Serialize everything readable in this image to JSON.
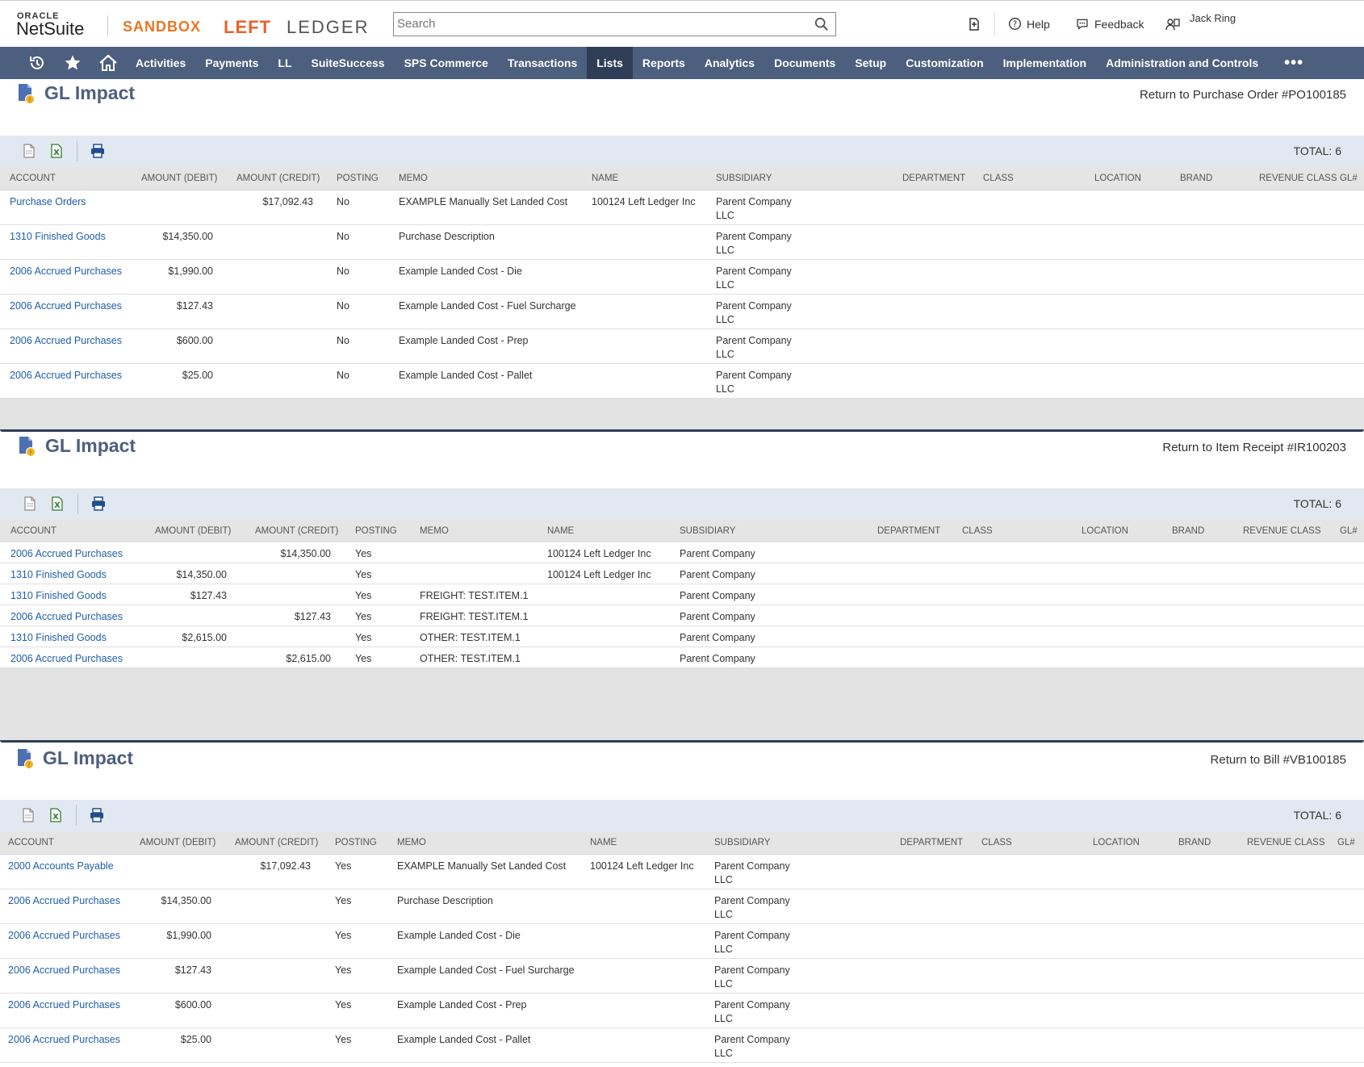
{
  "header": {
    "oracle": "ORACLE",
    "netsuite": "NetSuite",
    "sandbox": "SANDBOX",
    "brand_left": "LEFT",
    "brand_ledger": "LEDGER",
    "search_placeholder": "Search",
    "recent_icon": "recent-records-icon",
    "help": "Help",
    "feedback": "Feedback",
    "user": "Jack Ring"
  },
  "nav": {
    "items": [
      "Activities",
      "Payments",
      "LL",
      "SuiteSuccess",
      "SPS Commerce",
      "Transactions",
      "Lists",
      "Reports",
      "Analytics",
      "Documents",
      "Setup",
      "Customization",
      "Implementation",
      "Administration and Controls"
    ],
    "active": "Lists",
    "more": "•••"
  },
  "colors": {
    "nav_bg": "#4d5f7e",
    "nav_active": "#2f3e56",
    "link": "#1f5ea8",
    "title": "#4d5f7e"
  },
  "columns": [
    "ACCOUNT",
    "AMOUNT (DEBIT)",
    "AMOUNT (CREDIT)",
    "POSTING",
    "MEMO",
    "NAME",
    "SUBSIDIARY",
    "DEPARTMENT",
    "CLASS",
    "LOCATION",
    "BRAND",
    "REVENUE CLASS",
    "GL#"
  ],
  "sections": [
    {
      "title": "GL Impact",
      "return_link": "Return to Purchase Order #PO100185",
      "total": "TOTAL: 6",
      "rows": [
        {
          "account": "Purchase Orders",
          "debit": "",
          "credit": "$17,092.43",
          "posting": "No",
          "memo": "EXAMPLE Manually Set Landed Cost",
          "name": "100124 Left Ledger Inc",
          "subsidiary": "Parent Company LLC"
        },
        {
          "account": "1310 Finished Goods",
          "debit": "$14,350.00",
          "credit": "",
          "posting": "No",
          "memo": "Purchase Description",
          "name": "",
          "subsidiary": "Parent Company LLC"
        },
        {
          "account": "2006 Accrued Purchases",
          "debit": "$1,990.00",
          "credit": "",
          "posting": "No",
          "memo": "Example Landed Cost - Die",
          "name": "",
          "subsidiary": "Parent Company LLC"
        },
        {
          "account": "2006 Accrued Purchases",
          "debit": "$127.43",
          "credit": "",
          "posting": "No",
          "memo": "Example Landed Cost - Fuel Surcharge",
          "name": "",
          "subsidiary": "Parent Company LLC"
        },
        {
          "account": "2006 Accrued Purchases",
          "debit": "$600.00",
          "credit": "",
          "posting": "No",
          "memo": "Example Landed Cost - Prep",
          "name": "",
          "subsidiary": "Parent Company LLC"
        },
        {
          "account": "2006 Accrued Purchases",
          "debit": "$25.00",
          "credit": "",
          "posting": "No",
          "memo": "Example Landed Cost - Pallet",
          "name": "",
          "subsidiary": "Parent Company LLC"
        }
      ]
    },
    {
      "title": "GL Impact",
      "return_link": "Return to Item Receipt #IR100203",
      "total": "TOTAL: 6",
      "rows": [
        {
          "account": "2006 Accrued Purchases",
          "debit": "",
          "credit": "$14,350.00",
          "posting": "Yes",
          "memo": "",
          "name": "100124 Left Ledger Inc",
          "subsidiary": "Parent Company"
        },
        {
          "account": "1310 Finished Goods",
          "debit": "$14,350.00",
          "credit": "",
          "posting": "Yes",
          "memo": "",
          "name": "100124 Left Ledger Inc",
          "subsidiary": "Parent Company"
        },
        {
          "account": "1310 Finished Goods",
          "debit": "$127.43",
          "credit": "",
          "posting": "Yes",
          "memo": "FREIGHT: TEST.ITEM.1",
          "name": "",
          "subsidiary": "Parent Company"
        },
        {
          "account": "2006 Accrued Purchases",
          "debit": "",
          "credit": "$127.43",
          "posting": "Yes",
          "memo": "FREIGHT: TEST.ITEM.1",
          "name": "",
          "subsidiary": "Parent Company"
        },
        {
          "account": "1310 Finished Goods",
          "debit": "$2,615.00",
          "credit": "",
          "posting": "Yes",
          "memo": "OTHER: TEST.ITEM.1",
          "name": "",
          "subsidiary": "Parent Company"
        },
        {
          "account": "2006 Accrued Purchases",
          "debit": "",
          "credit": "$2,615.00",
          "posting": "Yes",
          "memo": "OTHER: TEST.ITEM.1",
          "name": "",
          "subsidiary": "Parent Company"
        }
      ]
    },
    {
      "title": "GL Impact",
      "return_link": "Return to Bill #VB100185",
      "total": "TOTAL: 6",
      "rows": [
        {
          "account": "2000 Accounts Payable",
          "debit": "",
          "credit": "$17,092.43",
          "posting": "Yes",
          "memo": "EXAMPLE Manually Set Landed Cost",
          "name": "100124 Left Ledger Inc",
          "subsidiary": "Parent Company LLC"
        },
        {
          "account": "2006 Accrued Purchases",
          "debit": "$14,350.00",
          "credit": "",
          "posting": "Yes",
          "memo": "Purchase Description",
          "name": "",
          "subsidiary": "Parent Company LLC"
        },
        {
          "account": "2006 Accrued Purchases",
          "debit": "$1,990.00",
          "credit": "",
          "posting": "Yes",
          "memo": "Example Landed Cost - Die",
          "name": "",
          "subsidiary": "Parent Company LLC"
        },
        {
          "account": "2006 Accrued Purchases",
          "debit": "$127.43",
          "credit": "",
          "posting": "Yes",
          "memo": "Example Landed Cost - Fuel Surcharge",
          "name": "",
          "subsidiary": "Parent Company LLC"
        },
        {
          "account": "2006 Accrued Purchases",
          "debit": "$600.00",
          "credit": "",
          "posting": "Yes",
          "memo": "Example Landed Cost - Prep",
          "name": "",
          "subsidiary": "Parent Company LLC"
        },
        {
          "account": "2006 Accrued Purchases",
          "debit": "$25.00",
          "credit": "",
          "posting": "Yes",
          "memo": "Example Landed Cost - Pallet",
          "name": "",
          "subsidiary": "Parent Company LLC"
        }
      ]
    }
  ]
}
